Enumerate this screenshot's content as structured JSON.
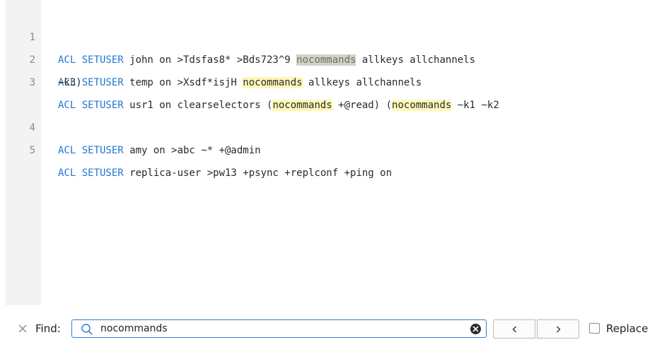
{
  "editor": {
    "lines": [
      {
        "number": "1",
        "kw": "ACL SETUSER",
        "a": " john on >Tdsfas8* >Bds723^9 ",
        "m1": "nocommands",
        "b": " allkeys allchannels"
      },
      {
        "number": "2",
        "kw": "ACL SETUSER",
        "a": " temp on >Xsdf*isjH ",
        "m1": "nocommands",
        "b": " allkeys allchannels"
      },
      {
        "number": "3",
        "kw": "ACL SETUSER",
        "a": " usr1 on clearselectors (",
        "m1": "nocommands",
        "b": " +@read) (",
        "m2": "nocommands",
        "c": " ~k1 ~k2",
        "wrap": "~k3)"
      },
      {
        "number": "4",
        "kw": "ACL SETUSER",
        "a": " amy on >abc ~* +@admin"
      },
      {
        "number": "5",
        "kw": "ACL SETUSER",
        "a": " replica-user >pw13 +psync +replconf +ping on"
      }
    ]
  },
  "findbar": {
    "label": "Find:",
    "query": "nocommands",
    "replace_label": "Replace",
    "replace_checked": false
  },
  "colors": {
    "keyword": "#1f78d1",
    "match_highlight": "#fff8b8",
    "current_match": "#d0d4c6",
    "gutter": "#f3f3f3",
    "focus_border": "#2f7fd6"
  }
}
